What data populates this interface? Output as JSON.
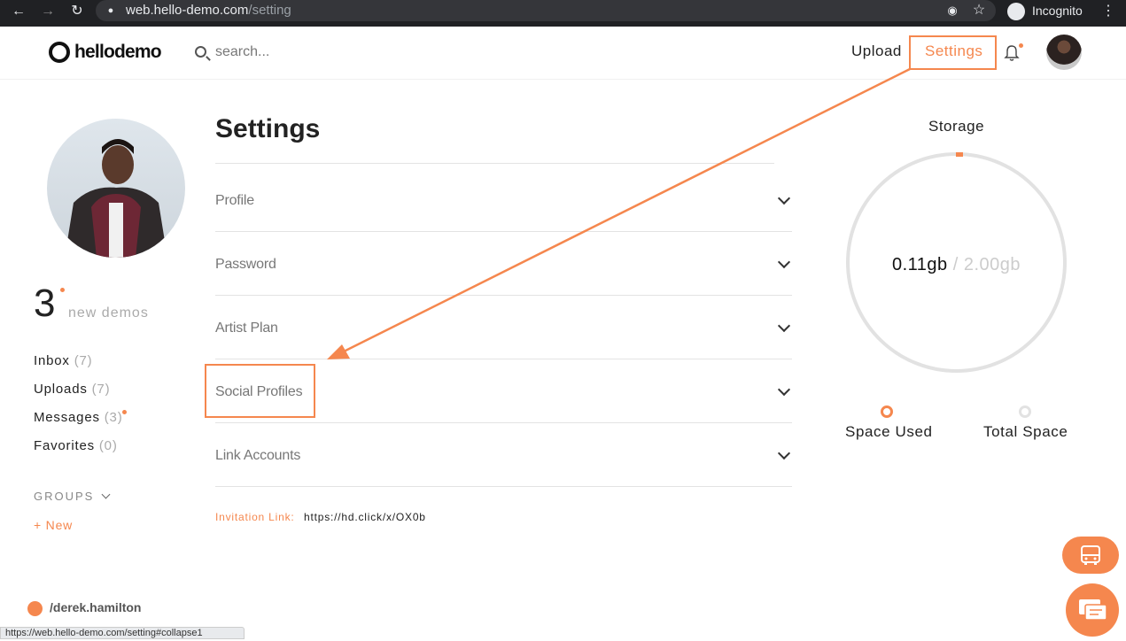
{
  "browser": {
    "url_host": "web.hello-demo.com",
    "url_path": "/setting",
    "profile_label": "Incognito",
    "status_url": "https://web.hello-demo.com/setting#collapse1"
  },
  "header": {
    "logo_text": "hellodemo",
    "search_placeholder": "search...",
    "upload_label": "Upload",
    "settings_label": "Settings"
  },
  "sidebar": {
    "demo_count": "3",
    "demo_label": "new demos",
    "items": [
      {
        "label": "Inbox",
        "count": "(7)"
      },
      {
        "label": "Uploads",
        "count": "(7)"
      },
      {
        "label": "Messages",
        "count": "(3)"
      },
      {
        "label": "Favorites",
        "count": "(0)"
      }
    ],
    "groups_label": "GROUPS",
    "new_label": "+ New",
    "username": "/derek.hamilton"
  },
  "settings": {
    "title": "Settings",
    "sections": [
      "Profile",
      "Password",
      "Artist Plan",
      "Social Profiles",
      "Link Accounts"
    ],
    "invitation_label": "Invitation Link:",
    "invitation_url": "https://hd.click/x/OX0b"
  },
  "storage": {
    "title": "Storage",
    "used": "0.11gb",
    "separator": "/",
    "total": "2.00gb",
    "used_fraction": 0.055,
    "legend_used": "Space Used",
    "legend_total": "Total Space"
  },
  "colors": {
    "accent": "#f5874e",
    "chrome_bg": "#202124"
  }
}
